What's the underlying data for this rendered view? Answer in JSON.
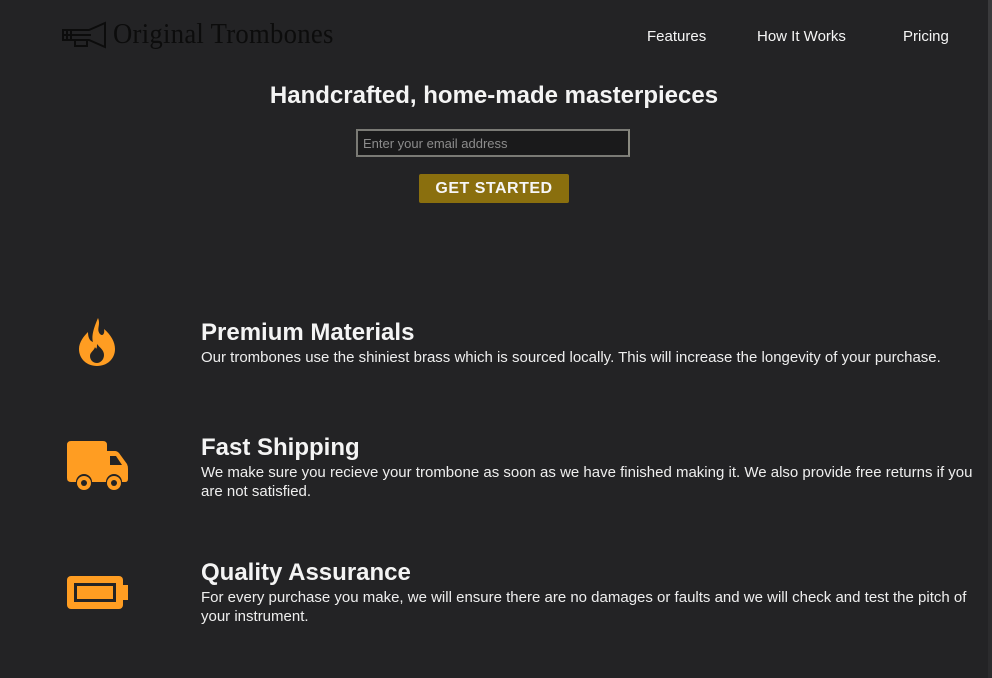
{
  "brand": {
    "name": "Original Trombones",
    "logo_icon": "trombone-icon"
  },
  "nav": {
    "items": [
      "Features",
      "How It Works",
      "Pricing"
    ]
  },
  "hero": {
    "title": "Handcrafted, home-made masterpieces",
    "email_placeholder": "Enter your email address",
    "cta_label": "GET STARTED"
  },
  "features": [
    {
      "icon": "fire-icon",
      "title": "Premium Materials",
      "description": "Our trombones use the shiniest brass which is sourced locally. This will increase the longevity of your purchase."
    },
    {
      "icon": "truck-icon",
      "title": "Fast Shipping",
      "description": "We make sure you recieve your trombone as soon as we have finished making it. We also provide free returns if you are not satisfied."
    },
    {
      "icon": "battery-icon",
      "title": "Quality Assurance",
      "description": "For every purchase you make, we will ensure there are no damages or faults and we will check and test the pitch of your instrument."
    }
  ],
  "colors": {
    "background": "#232325",
    "accent_orange": "#ff9d22",
    "button": "#8a6f0e",
    "logo_text": "#0c0c0c"
  }
}
